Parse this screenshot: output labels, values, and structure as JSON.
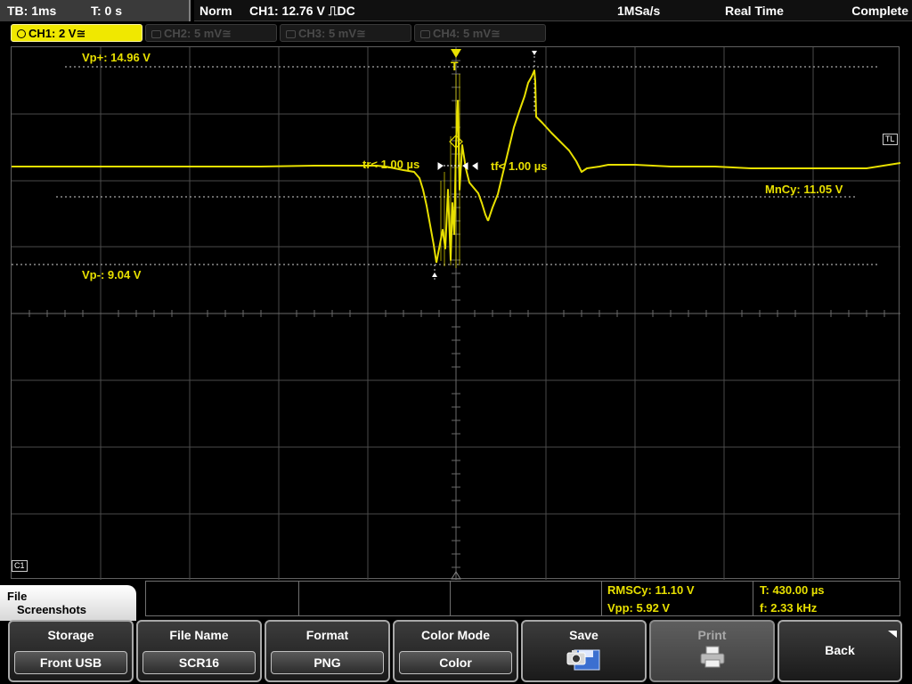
{
  "topbar": {
    "timebase": "TB: 1ms",
    "time_offset": "T: 0 s",
    "trigger_mode": "Norm",
    "trigger_level": "CH1: 12.76 V ⎍DC",
    "sample_rate": "1MSa/s",
    "acq_mode": "Real Time",
    "status": "Complete"
  },
  "channels": [
    {
      "label": "CH1: 2 V≅",
      "active": true
    },
    {
      "label": "CH2: 5 mV≅",
      "active": false
    },
    {
      "label": "CH3: 5 mV≅",
      "active": false
    },
    {
      "label": "CH4: 5 mV≅",
      "active": false
    }
  ],
  "screen": {
    "vp_plus": "Vp+: 14.96 V",
    "vp_minus": "Vp-: 9.04 V",
    "rise_time": "tr< 1.00 µs",
    "fall_time": "tf< 1.00 µs",
    "mean_cycle": "MnCy: 11.05 V",
    "trigger_marker": "T",
    "trigger_level_marker": "TL",
    "channel_marker": "C1"
  },
  "measurements": {
    "rms_cycle": "RMSCy: 11.10 V",
    "vpp": "Vpp: 5.92 V",
    "period": "T: 430.00 µs",
    "frequency": "f: 2.33 kHz"
  },
  "menu": {
    "title_line1": "File",
    "title_line2": "Screenshots",
    "softkeys": [
      {
        "title": "Storage",
        "value": "Front USB"
      },
      {
        "title": "File Name",
        "value": "SCR16"
      },
      {
        "title": "Format",
        "value": "PNG"
      },
      {
        "title": "Color Mode",
        "value": "Color"
      },
      {
        "title": "Save",
        "icon": "camera-save-icon"
      },
      {
        "title": "Print",
        "icon": "printer-icon",
        "disabled": true
      },
      {
        "title": "Back"
      }
    ]
  },
  "colors": {
    "ch1": "#e8e000",
    "grid": "#5a5a5a",
    "background": "#000000"
  }
}
